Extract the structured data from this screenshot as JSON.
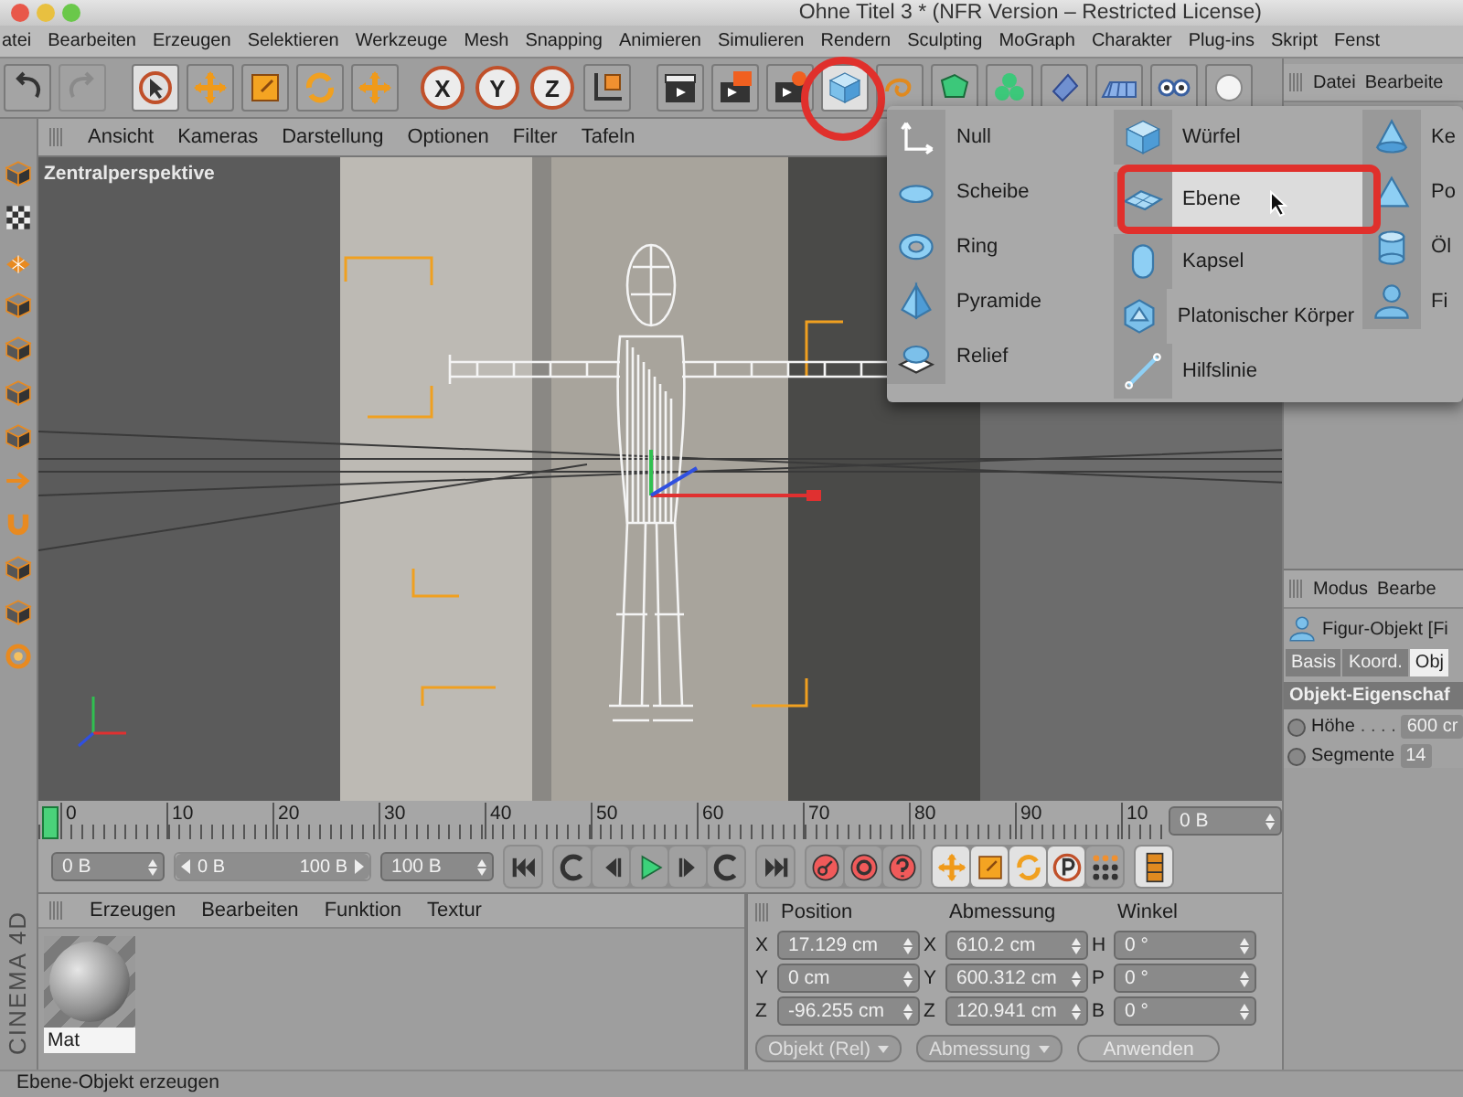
{
  "window": {
    "title": "Ohne Titel 3 * (NFR Version – Restricted License)"
  },
  "menu_bar": [
    "atei",
    "Bearbeiten",
    "Erzeugen",
    "Selektieren",
    "Werkzeuge",
    "Mesh",
    "Snapping",
    "Animieren",
    "Simulieren",
    "Rendern",
    "Sculpting",
    "MoGraph",
    "Charakter",
    "Plug-ins",
    "Skript",
    "Fenst"
  ],
  "toolbar": {
    "tools": [
      {
        "kind": "undo",
        "selected": false,
        "disabled": false
      },
      {
        "kind": "redo",
        "selected": false,
        "disabled": true
      },
      {
        "kind": "select",
        "selected": true,
        "disabled": false
      },
      {
        "kind": "move",
        "selected": false,
        "disabled": false
      },
      {
        "kind": "scale",
        "selected": false,
        "disabled": false
      },
      {
        "kind": "rotate",
        "selected": false,
        "disabled": false
      },
      {
        "kind": "move",
        "selected": false,
        "disabled": false
      },
      {
        "kind": "axis",
        "label": "X",
        "selected": true,
        "disabled": false
      },
      {
        "kind": "axis",
        "label": "Y",
        "selected": true,
        "disabled": false
      },
      {
        "kind": "axis",
        "label": "Z",
        "selected": true,
        "disabled": false
      },
      {
        "kind": "coord",
        "selected": false,
        "disabled": false
      },
      {
        "kind": "render",
        "selected": false,
        "disabled": false
      },
      {
        "kind": "render-view",
        "selected": false,
        "disabled": false
      },
      {
        "kind": "render-settings",
        "selected": false,
        "disabled": false
      },
      {
        "kind": "cube",
        "selected": true,
        "disabled": false
      },
      {
        "kind": "spline",
        "selected": false,
        "disabled": false
      },
      {
        "kind": "nurbs",
        "selected": false,
        "disabled": false
      },
      {
        "kind": "cloner",
        "selected": false,
        "disabled": false
      },
      {
        "kind": "deformer",
        "selected": false,
        "disabled": false
      },
      {
        "kind": "floor",
        "selected": false,
        "disabled": false
      },
      {
        "kind": "camera",
        "selected": false,
        "disabled": false
      },
      {
        "kind": "light",
        "selected": false,
        "disabled": false
      }
    ]
  },
  "viewport": {
    "menu": [
      "Ansicht",
      "Kameras",
      "Darstellung",
      "Optionen",
      "Filter",
      "Tafeln"
    ],
    "camera_label": "Zentralperspektive"
  },
  "object_menu": {
    "columns": [
      [
        {
          "label": "Null",
          "selected": false
        },
        {
          "label": "Scheibe",
          "selected": false
        },
        {
          "label": "Ring",
          "selected": false
        },
        {
          "label": "Pyramide",
          "selected": false
        },
        {
          "label": "Relief",
          "selected": false
        }
      ],
      [
        {
          "label": "Würfel",
          "selected": false
        },
        {
          "label": "Ebene",
          "selected": true
        },
        {
          "label": "Kapsel",
          "selected": false
        },
        {
          "label": "Platonischer Körper",
          "selected": false
        },
        {
          "label": "Hilfslinie",
          "selected": false
        }
      ],
      [
        {
          "label": "Ke",
          "selected": false
        },
        {
          "label": "Po",
          "selected": false
        },
        {
          "label": "Öl",
          "selected": false
        },
        {
          "label": "Fi",
          "selected": false
        }
      ]
    ]
  },
  "timeline": {
    "ticks": [
      "0",
      "10",
      "20",
      "30",
      "40",
      "50",
      "60",
      "70",
      "80",
      "90",
      "10"
    ],
    "frame_field": "0 B",
    "playhead": {
      "level": 0
    }
  },
  "transport": {
    "start_field": "0 B",
    "range": {
      "start": "0 B",
      "end": "100 B",
      "level": 1
    },
    "end_field": "100 B"
  },
  "material_manager": {
    "menu": [
      "Erzeugen",
      "Bearbeiten",
      "Funktion",
      "Textur"
    ],
    "materials": [
      {
        "name": "Mat"
      }
    ]
  },
  "logo_text": "CINEMA 4D",
  "coordinates": {
    "headers": [
      "Position",
      "Abmessung",
      "Winkel"
    ],
    "rows": [
      [
        {
          "axis": "X",
          "value": "17.129 cm"
        },
        {
          "axis": "X",
          "value": "610.2 cm"
        },
        {
          "axis": "H",
          "value": "0 °"
        }
      ],
      [
        {
          "axis": "Y",
          "value": "0 cm"
        },
        {
          "axis": "Y",
          "value": "600.312 cm"
        },
        {
          "axis": "P",
          "value": "0 °"
        }
      ],
      [
        {
          "axis": "Z",
          "value": "-96.255 cm"
        },
        {
          "axis": "Z",
          "value": "120.941 cm"
        },
        {
          "axis": "B",
          "value": "0 °"
        }
      ]
    ],
    "dropdowns": [
      "Objekt (Rel)",
      "Abmessung"
    ],
    "apply_button": "Anwenden"
  },
  "object_manager": {
    "menu": [
      "Datei",
      "Bearbeite"
    ]
  },
  "attributes": {
    "menu": [
      "Modus",
      "Bearbe"
    ],
    "object_title": "Figur-Objekt [Fi",
    "tabs": [
      {
        "label": "Basis",
        "selected": false
      },
      {
        "label": "Koord.",
        "selected": false
      },
      {
        "label": "Obj",
        "selected": true
      }
    ],
    "section": "Objekt-Eigenschaf",
    "fields": [
      {
        "label": "Höhe",
        "dots": ". . . .",
        "value": "600 cr",
        "animated": false
      },
      {
        "label": "Segmente",
        "value": "14",
        "animated": false
      }
    ]
  },
  "status_bar": "Ebene-Objekt erzeugen"
}
